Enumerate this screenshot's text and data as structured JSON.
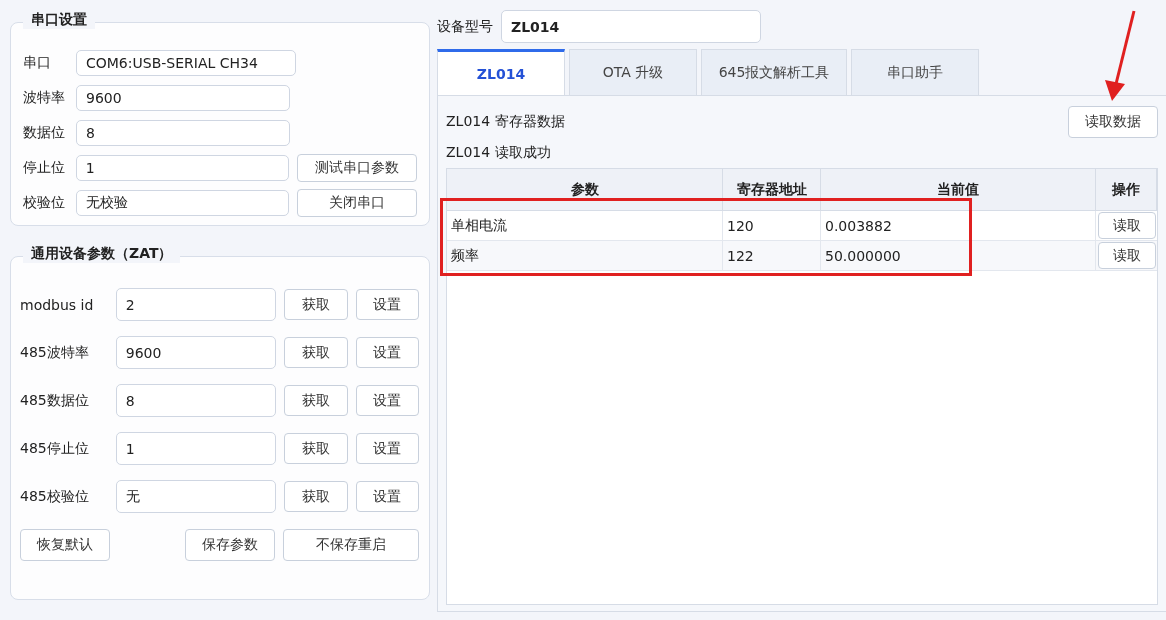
{
  "serial_settings": {
    "title": "串口设置",
    "fields": [
      {
        "label": "串口",
        "value": "COM6:USB-SERIAL CH34"
      },
      {
        "label": "波特率",
        "value": "9600"
      },
      {
        "label": "数据位",
        "value": "8"
      },
      {
        "label": "停止位",
        "value": "1",
        "button": "测试串口参数"
      },
      {
        "label": "校验位",
        "value": "无校验",
        "button": "关闭串口"
      }
    ]
  },
  "device_params": {
    "title": "通用设备参数（ZAT）",
    "rows": [
      {
        "label": "modbus id",
        "value": "2",
        "get": "获取",
        "set": "设置"
      },
      {
        "label": "485波特率",
        "value": "9600",
        "get": "获取",
        "set": "设置"
      },
      {
        "label": "485数据位",
        "value": "8",
        "get": "获取",
        "set": "设置"
      },
      {
        "label": "485停止位",
        "value": "1",
        "get": "获取",
        "set": "设置"
      },
      {
        "label": "485校验位",
        "value": "无",
        "get": "获取",
        "set": "设置"
      }
    ],
    "buttons": [
      "恢复默认",
      "保存参数",
      "不保存重启"
    ]
  },
  "device_model": {
    "label": "设备型号",
    "value": "ZL014"
  },
  "tabs": [
    {
      "label": "ZL014",
      "selected": true
    },
    {
      "label": "OTA 升级",
      "selected": false
    },
    {
      "label": "645报文解析工具",
      "selected": false
    },
    {
      "label": "串口助手",
      "selected": false
    }
  ],
  "register_panel": {
    "title": "ZL014 寄存器数据",
    "read_button": "读取数据",
    "status": "ZL014 读取成功",
    "table": {
      "columns": [
        "参数",
        "寄存器地址",
        "当前值",
        "操作"
      ],
      "rows": [
        {
          "cells": [
            "单相电流",
            "120",
            "0.003882"
          ],
          "action": "读取"
        },
        {
          "cells": [
            "频率",
            "122",
            "50.000000"
          ],
          "action": "读取"
        }
      ]
    }
  }
}
